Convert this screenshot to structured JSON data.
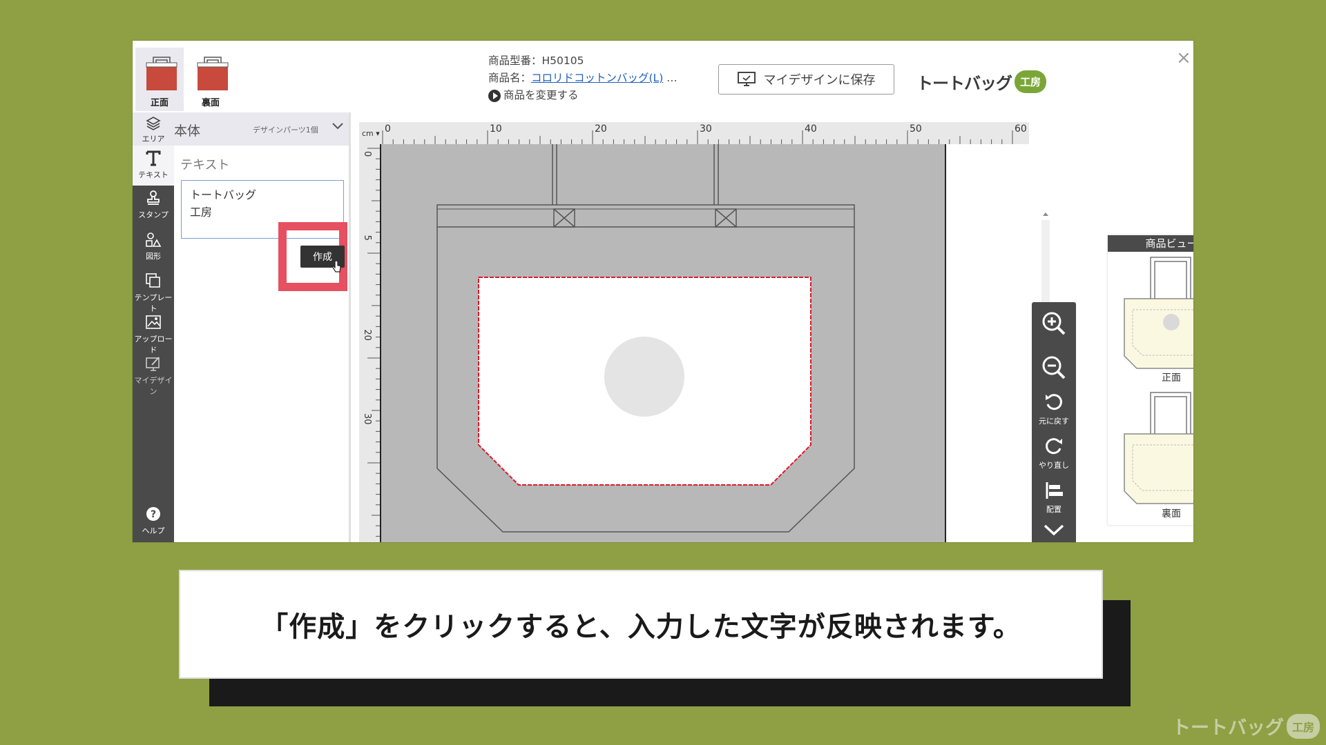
{
  "header": {
    "views": [
      {
        "label": "正面"
      },
      {
        "label": "裏面"
      }
    ],
    "product_code_label": "商品型番：H50105",
    "product_name_prefix": "商品名：",
    "product_name_link": "コロリドコットンバッグ(L)",
    "product_name_ellipsis": " …",
    "change_product_label": "商品を変更する",
    "save_label": "マイデザインに保存",
    "logo_text": "トートバッグ",
    "logo_badge": "工房",
    "close_label": "×"
  },
  "toolbar": {
    "items": [
      {
        "label": "エリア"
      },
      {
        "label": "テキスト"
      },
      {
        "label": "スタンプ"
      },
      {
        "label": "図形"
      },
      {
        "label": "テンプレート"
      },
      {
        "label": "アップロード"
      },
      {
        "label": "マイデザイン"
      },
      {
        "label": "ヘルプ"
      }
    ]
  },
  "panel": {
    "area_name": "本体",
    "parts_count": "デザインパーツ1個",
    "section_title": "テキスト",
    "text_value": "トートバッグ\n工房",
    "create_label": "作成"
  },
  "canvas": {
    "unit": "cm",
    "top_ticks": [
      "0",
      "10",
      "20",
      "30",
      "40",
      "50",
      "60"
    ],
    "left_ticks": [
      "0",
      "5",
      "20",
      "30"
    ]
  },
  "zoom": {
    "undo_label": "元に戻す",
    "redo_label": "やり直し",
    "align_label": "配置"
  },
  "product_view": {
    "title": "商品ビュー",
    "front_label": "正面",
    "back_label": "裏面"
  },
  "caption": {
    "text": "「作成」をクリックすると、入力した文字が反映されます。"
  },
  "watermark": {
    "text": "トートバッグ",
    "badge": "工房"
  },
  "colors": {
    "background": "#8ea043",
    "bag_red": "#c84a3c",
    "highlight": "#e65060",
    "toolbar": "#4a4a4a"
  }
}
